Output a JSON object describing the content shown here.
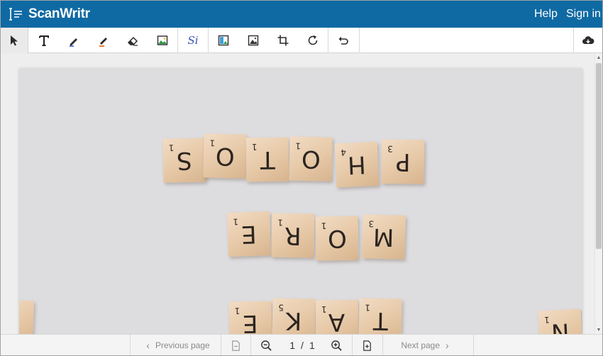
{
  "header": {
    "app_name": "ScanWritr",
    "help_label": "Help",
    "signin_label": "Sign in",
    "bg_color": "#0f6aa3"
  },
  "toolbar": {
    "tools": [
      {
        "name": "select-icon"
      },
      {
        "name": "text-icon"
      },
      {
        "name": "pen-icon"
      },
      {
        "name": "highlighter-icon"
      },
      {
        "name": "eraser-icon"
      },
      {
        "name": "image-icon"
      },
      {
        "name": "signature-icon",
        "label": "Si"
      },
      {
        "name": "image-adjust-icon"
      },
      {
        "name": "image-filter-icon"
      },
      {
        "name": "crop-icon"
      },
      {
        "name": "rotate-icon"
      },
      {
        "name": "undo-icon"
      },
      {
        "name": "cloud-download-icon"
      }
    ]
  },
  "document": {
    "row1": [
      "S",
      "O",
      "T",
      "O",
      "H",
      "P"
    ],
    "row1_sub": [
      "1",
      "1",
      "1",
      "1",
      "4",
      "3"
    ],
    "row2": [
      "E",
      "R",
      "O",
      "M"
    ],
    "row2_sub": [
      "1",
      "1",
      "1",
      "3"
    ],
    "row3": [
      "E",
      "K",
      "A",
      "T"
    ],
    "row3_sub": [
      "1",
      "5",
      "1",
      "1"
    ],
    "row3_extra": "N",
    "row3_extra_sub": "1"
  },
  "bottombar": {
    "previous_label": "Previous page",
    "next_label": "Next page",
    "current_page": "1",
    "page_separator": "/",
    "total_pages": "1"
  }
}
